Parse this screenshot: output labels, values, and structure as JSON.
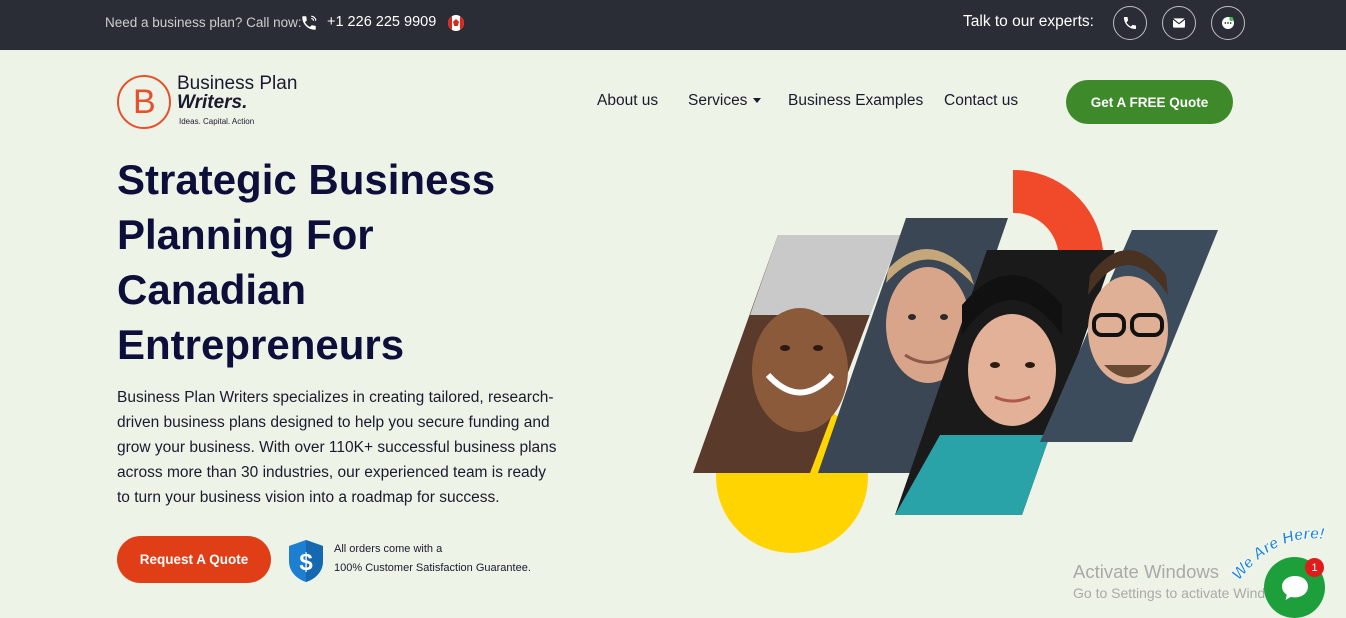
{
  "topbar": {
    "call_text": "Need a business plan? Call now:",
    "phone": "+1 226 225 9909",
    "flag_icon": "canada-flag-icon",
    "talk_text": "Talk to our experts:",
    "contact_icons": [
      "phone-icon",
      "email-icon",
      "chat-icon"
    ]
  },
  "header": {
    "logo_mark": "B",
    "logo_title": "Business Plan",
    "logo_writers": "Writers.",
    "logo_tagline": "Ideas. Capital. Action",
    "nav": [
      {
        "label": "About us"
      },
      {
        "label": "Services"
      },
      {
        "label": "Business Examples"
      },
      {
        "label": "Contact us"
      }
    ],
    "cta_label": "Get A FREE Quote"
  },
  "hero": {
    "title_lines": [
      "Strategic Business",
      "Planning For",
      "Canadian",
      "Entrepreneurs"
    ],
    "description": "Business Plan Writers specializes in creating tailored, research-driven business plans designed to help you secure funding and grow your business. With over 110K+ successful business plans across more than 30 industries, our experienced team is ready to turn your business vision into a roadmap for success.",
    "request_button": "Request A Quote",
    "guarantee_line1": "All orders come with a",
    "guarantee_line2": "100% Customer Satisfaction Guarantee."
  },
  "watermark": {
    "line1": "Activate Windows",
    "line2": "Go to Settings to activate Windows."
  },
  "chat": {
    "banner": "We Are Here!",
    "badge_count": "1"
  },
  "colors": {
    "topbar_bg": "#2a2d35",
    "page_bg": "#eef3e8",
    "brand_orange": "#e8502c",
    "cta_green": "#3e8a2a",
    "request_red": "#e03e16",
    "title_navy": "#0d0f3a",
    "accent_yellow": "#ffd400",
    "accent_red": "#f04a2a"
  }
}
